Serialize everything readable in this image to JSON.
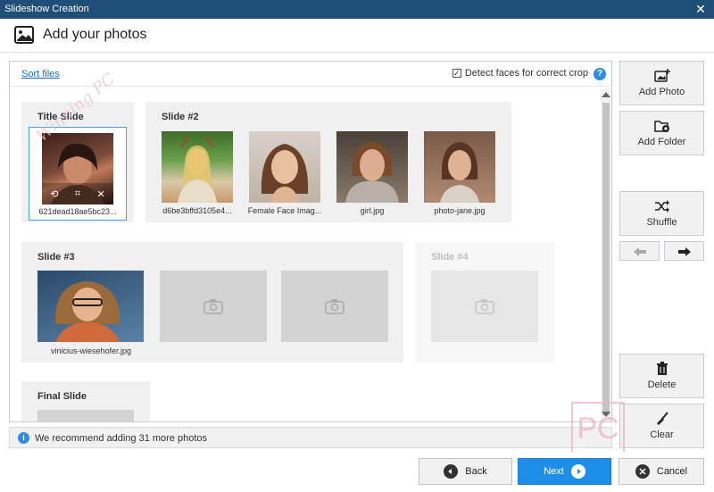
{
  "window": {
    "title": "Slideshow Creation",
    "close_glyph": "✕"
  },
  "header": {
    "title": "Add your photos",
    "icon": "photo-icon"
  },
  "toolbar": {
    "sort_label": "Sort files",
    "detect_label": "Detect faces for correct crop",
    "detect_checked": true,
    "help_glyph": "?"
  },
  "slides": {
    "title": {
      "label": "Title Slide",
      "photo_caption": "621dead18ae5bc23..."
    },
    "slide2": {
      "label": "Slide #2",
      "captions": [
        "d6be3bffd3105e4...",
        "Female Face Imag...",
        "girl.jpg",
        "photo-jane.jpg"
      ]
    },
    "slide3": {
      "label": "Slide #3",
      "captions": [
        "vinicius-wiesehofer.jpg"
      ]
    },
    "slide4": {
      "label": "Slide #4"
    },
    "final": {
      "label": "Final Slide"
    }
  },
  "sidebar": {
    "add_photo": "Add Photo",
    "add_folder": "Add Folder",
    "shuffle": "Shuffle",
    "delete": "Delete",
    "clear": "Clear"
  },
  "info": {
    "icon": "info-icon",
    "text": "We recommend adding 31 more photos"
  },
  "footer": {
    "back": "Back",
    "next": "Next",
    "cancel": "Cancel"
  },
  "watermark": {
    "letters": "PC",
    "script_text": "Winning PC"
  },
  "colors": {
    "titlebar": "#1f4e79",
    "accent": "#1e8ee9",
    "link": "#1a6fc4",
    "slide_bg": "#f0f0f0"
  }
}
